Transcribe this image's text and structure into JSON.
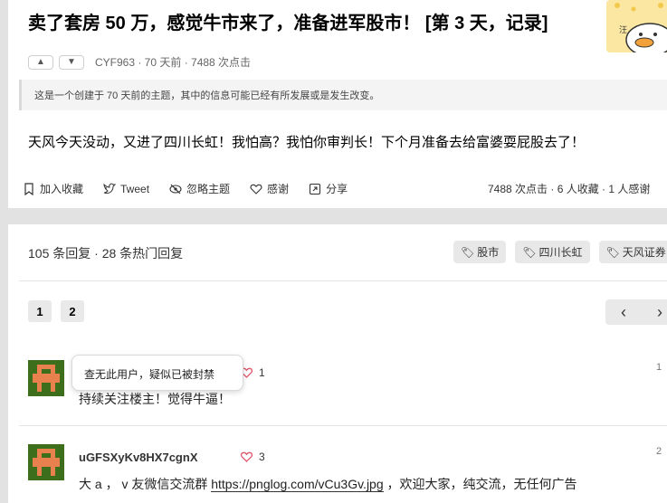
{
  "topic": {
    "title": "卖了套房 50 万，感觉牛市来了，准备进军股市！ [第 3 天，记录]",
    "meta": "CYF963 · 70 天前 · 7488 次点击",
    "notice": "这是一个创建于 70 天前的主题，其中的信息可能已经有所发展或是发生改变。",
    "body": "天风今天没动，又进了四川长虹！我怕高？我怕你审判长！下个月准备去给富婆耍屁股去了！",
    "toolbar": [
      "加入收藏",
      "Tweet",
      "忽略主题",
      "感谢",
      "分享"
    ],
    "stats": "7488 次点击 · 6 人收藏 · 1 人感谢"
  },
  "replies": {
    "count": "105 条回复 · 28 条热门回复",
    "tags": [
      "股市",
      "四川长虹",
      "天风证券"
    ],
    "pages": [
      "1",
      "2"
    ],
    "pager": {
      "prev": "‹",
      "next": "›"
    },
    "items": [
      {
        "username": "",
        "likes": "1",
        "floor": "1",
        "text": "持续关注楼主！觉得牛逼！"
      },
      {
        "username": "uGFSXyKv8HX7cgnX",
        "likes": "3",
        "floor": "2",
        "text_before": "大 a ， v 友微信交流群 ",
        "link": "https://pnglog.com/vCu3Gv.jpg",
        "text_after": " ，欢迎大家，纯交流，无任何广告"
      }
    ],
    "tooltip": "查无此用户，疑似已被封禁"
  },
  "colors": {
    "accent_heart": "#e0576b",
    "avatar_green": "#3c6e1c",
    "avatar_orange": "#e8814d",
    "mascot_bg": "#fbe7a1"
  }
}
